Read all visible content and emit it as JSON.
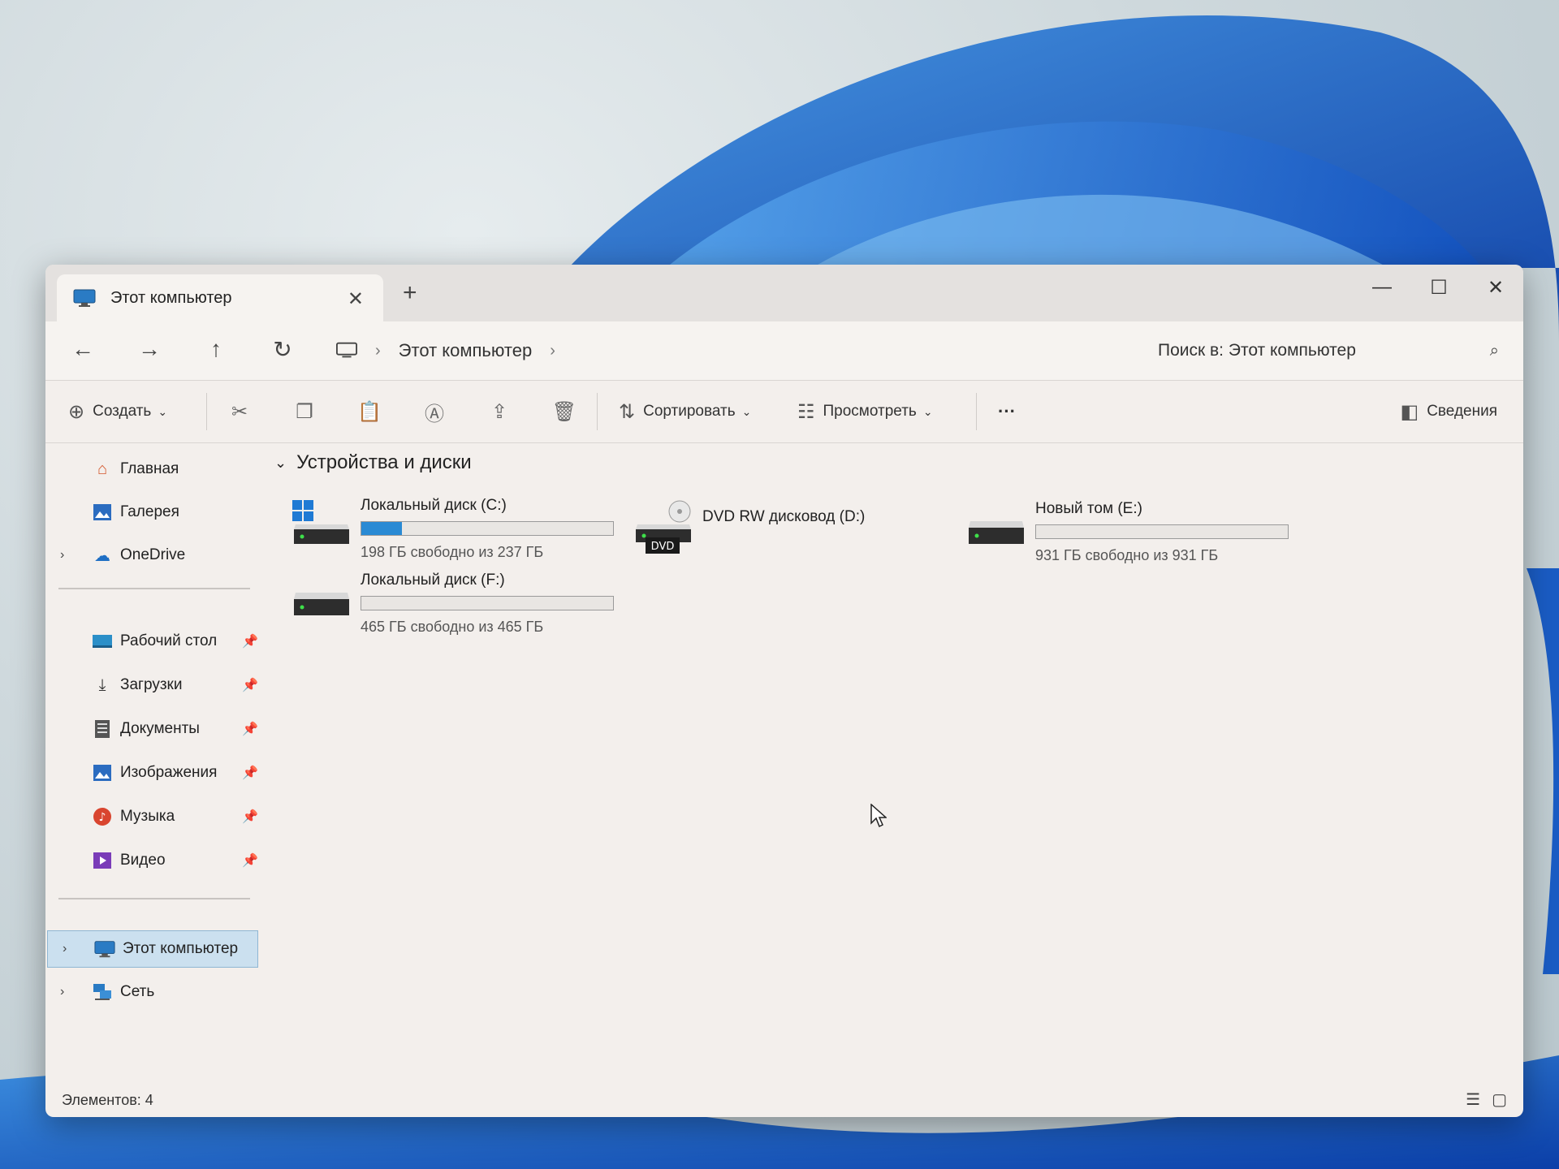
{
  "tab": {
    "title": "Этот компьютер",
    "icon": "monitor-icon"
  },
  "address": {
    "crumb": "Этот компьютер"
  },
  "search": {
    "placeholder": "Поиск в: Этот компьютер"
  },
  "command_bar": {
    "create_label": "Создать",
    "sort_label": "Сортировать",
    "view_label": "Просмотреть",
    "more_label": "···",
    "details_label": "Сведения"
  },
  "sidebar": {
    "top": [
      {
        "label": "Главная",
        "icon": "home-icon"
      },
      {
        "label": "Галерея",
        "icon": "gallery-icon"
      },
      {
        "label": "OneDrive",
        "icon": "cloud-icon"
      }
    ],
    "pinned": [
      {
        "label": "Рабочий стол",
        "icon": "desktop-icon"
      },
      {
        "label": "Загрузки",
        "icon": "download-icon"
      },
      {
        "label": "Документы",
        "icon": "documents-icon"
      },
      {
        "label": "Изображения",
        "icon": "pictures-icon"
      },
      {
        "label": "Музыка",
        "icon": "music-icon"
      },
      {
        "label": "Видео",
        "icon": "video-icon"
      }
    ],
    "bottom": [
      {
        "label": "Этот компьютер",
        "icon": "monitor-icon",
        "selected": true
      },
      {
        "label": "Сеть",
        "icon": "network-icon"
      }
    ]
  },
  "content": {
    "group_title": "Устройства и диски",
    "drives": [
      {
        "name": "Локальный диск (C:)",
        "info": "198 ГБ свободно из 237 ГБ",
        "used_fraction": 0.16,
        "icon": "windows-drive-icon"
      },
      {
        "name": "DVD RW дисковод (D:)",
        "icon": "dvd-drive-icon",
        "dvd_label": "DVD"
      },
      {
        "name": "Новый том (E:)",
        "info": "931 ГБ свободно из 931 ГБ",
        "used_fraction": 0.0,
        "icon": "hard-drive-icon"
      },
      {
        "name": "Локальный диск (F:)",
        "info": "465 ГБ свободно из 465 ГБ",
        "used_fraction": 0.0,
        "icon": "hard-drive-icon"
      }
    ]
  },
  "status": {
    "text": "Элементов: 4"
  },
  "colors": {
    "accent": "#2a8ad4",
    "selected_bg": "#cbe0ef",
    "window_bg": "#f3efec"
  }
}
